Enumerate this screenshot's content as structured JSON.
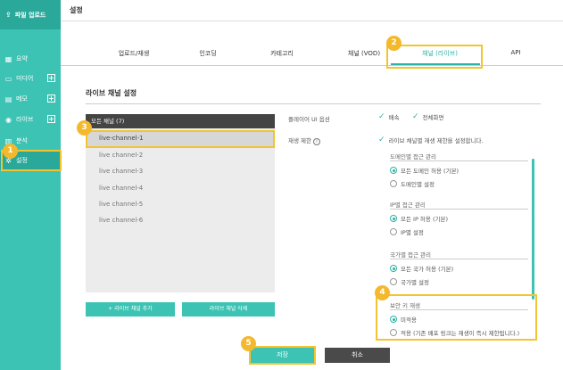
{
  "sidebar": {
    "upload_label": "파일 업로드",
    "items": [
      {
        "label": "요약",
        "icon": "grid-icon",
        "plus": false
      },
      {
        "label": "미디어",
        "icon": "monitor-icon",
        "plus": true
      },
      {
        "label": "메모",
        "icon": "memo-icon",
        "plus": true
      },
      {
        "label": "라이브",
        "icon": "broadcast-icon",
        "plus": true
      },
      {
        "label": "분석",
        "icon": "chart-icon",
        "plus": false
      },
      {
        "label": "설정",
        "icon": "gear-icon",
        "plus": false
      }
    ]
  },
  "header": {
    "title": "설정"
  },
  "tabs": [
    "업로드/재생",
    "인코딩",
    "카테고리",
    "채널 (VOD)",
    "채널 (라이브)",
    "API"
  ],
  "section_title": "라이브 채널 설정",
  "channel_list": {
    "header": "모든 채널 (7)",
    "items": [
      "live-channel-1",
      "live channel-2",
      "live channel-3",
      "live channel-4",
      "live channel-5",
      "live channel-6"
    ],
    "add_button": "+ 라이브 채널 추가",
    "delete_button": "라이브 채널 삭제"
  },
  "settings": {
    "player_ui_label": "플레이어 UI 옵션",
    "player_ui_options": [
      "배속",
      "전체화면"
    ],
    "restriction_label": "재생 제한",
    "restriction_check": "라이브 채널별 재생 제한을 설정합니다.",
    "domain": {
      "title": "도메인별 접근 관리",
      "options": [
        "모든 도메인 허용 (기본)",
        "도메인별 설정"
      ]
    },
    "ip": {
      "title": "IP별 접근 관리",
      "options": [
        "모든 IP 허용 (기본)",
        "IP별 설정"
      ]
    },
    "country": {
      "title": "국가별 접근 관리",
      "options": [
        "모든 국가 허용 (기본)",
        "국가별 설정"
      ]
    },
    "security": {
      "title": "보안 키 재생",
      "options": [
        "미적용",
        "적용 (기존 배포 링크는 재생이 즉시 제한됩니다.)"
      ]
    }
  },
  "footer": {
    "save": "저장",
    "cancel": "취소"
  },
  "badges": [
    "1",
    "2",
    "3",
    "4",
    "5"
  ],
  "colors": {
    "accent": "#3cc3b4",
    "highlight": "#f4c430",
    "badge": "#f4b82d"
  }
}
